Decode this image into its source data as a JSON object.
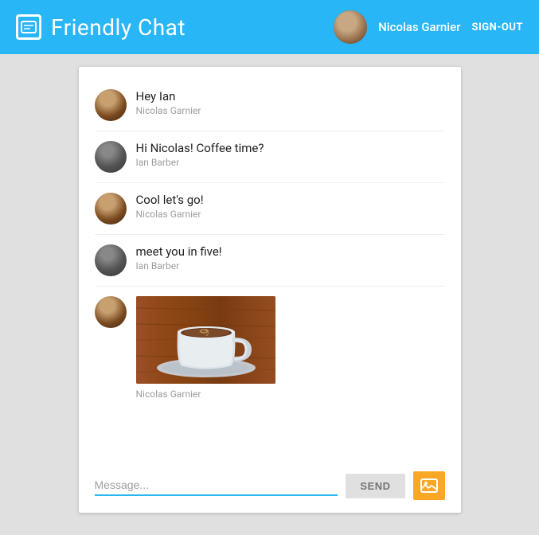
{
  "header": {
    "title": "Friendly Chat",
    "username": "Nicolas Garnier",
    "signout_label": "SIGN-OUT"
  },
  "messages": [
    {
      "id": 1,
      "text": "Hey Ian",
      "author": "Nicolas Garnier",
      "avatar_type": "nicolas"
    },
    {
      "id": 2,
      "text": "Hi Nicolas! Coffee time?",
      "author": "Ian Barber",
      "avatar_type": "ian"
    },
    {
      "id": 3,
      "text": "Cool let's go!",
      "author": "Nicolas Garnier",
      "avatar_type": "nicolas"
    },
    {
      "id": 4,
      "text": "meet you in five!",
      "author": "Ian Barber",
      "avatar_type": "ian"
    },
    {
      "id": 5,
      "text": "",
      "author": "Nicolas Garnier",
      "avatar_type": "nicolas",
      "has_image": true
    }
  ],
  "input": {
    "placeholder": "Message...",
    "send_label": "SEND"
  },
  "colors": {
    "header_bg": "#29b6f6",
    "accent": "#29b6f6",
    "image_button_bg": "#f9a825"
  }
}
